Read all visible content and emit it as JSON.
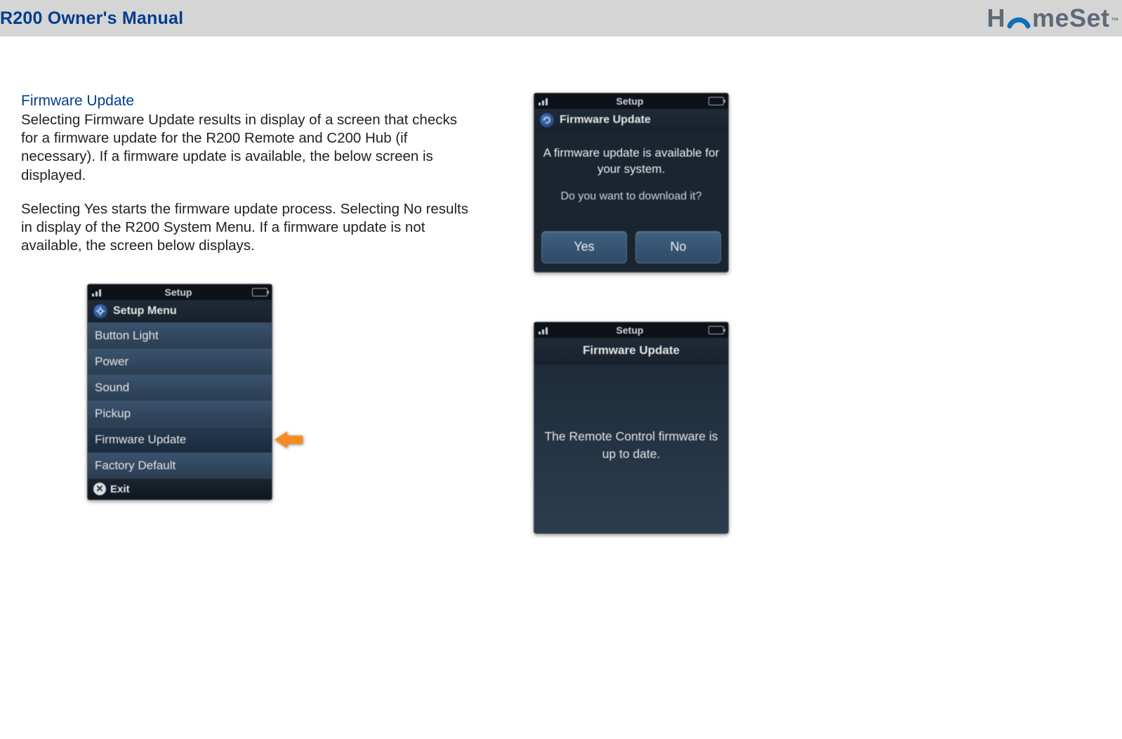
{
  "header": {
    "title": "R200 Owner's Manual",
    "brand_before": "H",
    "brand_after": "meSet",
    "trademark": "™"
  },
  "section": {
    "heading": "Firmware Update",
    "paragraph1": "Selecting Firmware Update results in display of a screen that checks for a firmware update for the R200 Remote and C200 Hub (if necessary). If a firmware update is available, the below screen is displayed.",
    "paragraph2": "Selecting Yes starts the firmware update process. Selecting No results in display of the R200 System Menu. If a firmware update is not available, the screen below displays."
  },
  "phone_common": {
    "status_title": "Setup"
  },
  "menu_screen": {
    "header": "Setup Menu",
    "items": [
      "Button Light",
      "Power",
      "Sound",
      "Pickup",
      "Firmware Update",
      "Factory Default"
    ],
    "selected_index": 4,
    "softkey": "Exit"
  },
  "dialog_screen": {
    "header": "Firmware Update",
    "line1": "A firmware update is available for your system.",
    "line2": "Do you want to download it?",
    "yes": "Yes",
    "no": "No"
  },
  "uptodate_screen": {
    "header": "Firmware Update",
    "body": "The Remote Control firmware is up to date."
  }
}
